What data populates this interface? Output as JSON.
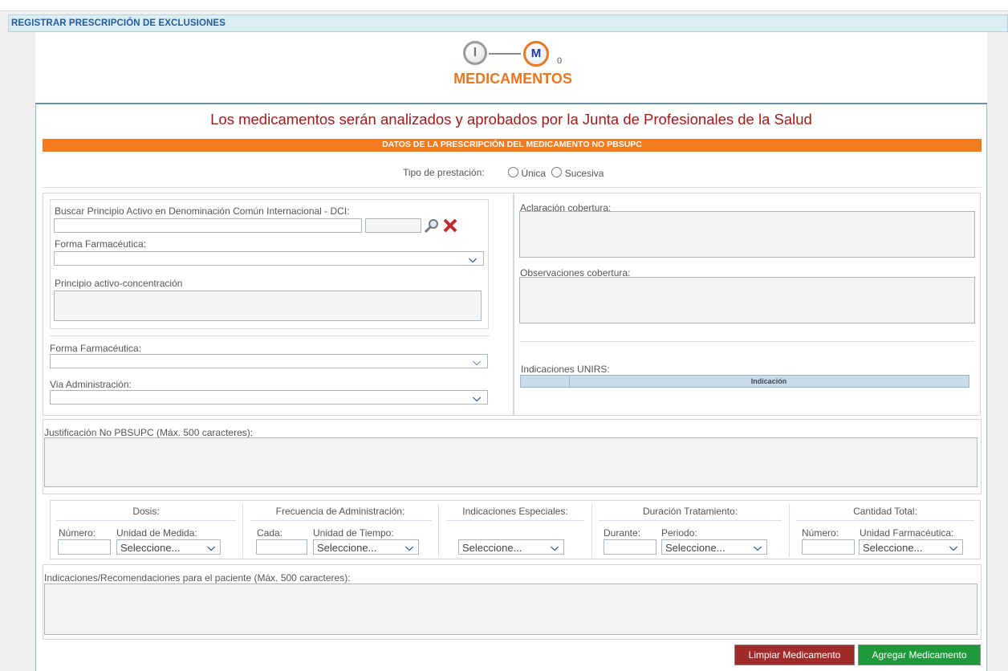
{
  "page": {
    "title": "REGISTRAR PRESCRIPCIÓN DE EXCLUSIONES"
  },
  "stepper": {
    "step1_letter": "I",
    "step2_letter": "M",
    "step2_count": "0",
    "title": "MEDICAMENTOS"
  },
  "notice": "Los medicamentos serán analizados y aprobados por la Junta de Profesionales de la Salud",
  "section_title": "DATOS DE LA PRESCRIPCIÓN DEL MEDICAMENTO NO PBSUPC",
  "tipo": {
    "label": "Tipo de prestación:",
    "options": [
      "Única",
      "Sucesiva"
    ]
  },
  "left": {
    "dci_label": "Buscar Principio Activo en Denominación Común Internacional - DCI:",
    "forma1_label": "Forma Farmacéutica:",
    "principio_label": "Principio activo-concentración",
    "forma2_label": "Forma Farmacéutica:",
    "via_label": "Via Administración:"
  },
  "right": {
    "aclaracion_label": "Aclaración cobertura:",
    "observaciones_label": "Observaciones cobertura:",
    "unirs_label": "Indicaciones UNIRS:",
    "unirs_col": "Indicación"
  },
  "justificacion_label": "Justificación No PBSUPC (Máx. 500 caracteres):",
  "groups": {
    "dosis": {
      "title": "Dosis:",
      "num_label": "Número:",
      "unit_label": "Unidad de Medida:",
      "select": "Seleccione..."
    },
    "frecuencia": {
      "title": "Frecuencia de Administración:",
      "cada_label": "Cada:",
      "unit_label": "Unidad de Tiempo:",
      "select": "Seleccione..."
    },
    "especiales": {
      "title": "Indicaciones Especiales:",
      "select": "Seleccione..."
    },
    "duracion": {
      "title": "Duración Tratamiento:",
      "durante_label": "Durante:",
      "periodo_label": "Periodo:",
      "select": "Seleccione..."
    },
    "cantidad": {
      "title": "Cantidad Total:",
      "num_label": "Número:",
      "unit_label": "Unidad Farmacéutica:",
      "select": "Seleccione..."
    }
  },
  "recomendaciones_label": "Indicaciones/Recomendaciones para el paciente (Máx. 500 caracteres):",
  "buttons": {
    "limpiar": "Limpiar Medicamento",
    "agregar": "Agregar Medicamento"
  },
  "colors": {
    "accent": "#f47c20",
    "header_text": "#1f5d9f",
    "notice": "#a11b1b",
    "btn_limpiar": "#a02a2a",
    "btn_agregar": "#1e9a3a"
  }
}
